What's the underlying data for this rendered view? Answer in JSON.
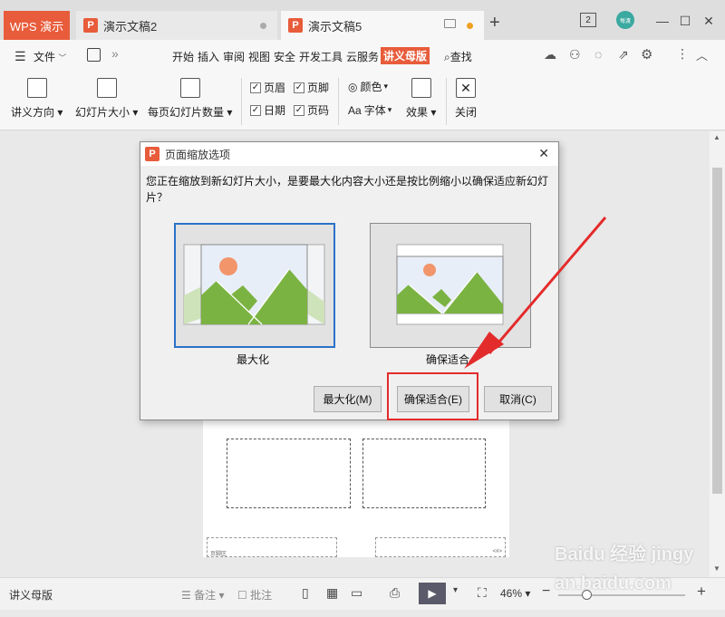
{
  "titlebar": {
    "app_tab": "WPS 演示",
    "doc_tabs": [
      {
        "label": "演示文稿2",
        "active": false
      },
      {
        "label": "演示文稿5",
        "active": true
      }
    ],
    "new_tab": "+",
    "badge": "2",
    "avatar": "每渡"
  },
  "menubar": {
    "file": "文件",
    "items": [
      "开始",
      "插入",
      "审阅",
      "视图",
      "安全",
      "开发工具",
      "云服务"
    ],
    "active": "讲义母版",
    "search": "查找"
  },
  "ribbon": {
    "orientation": "讲义方向",
    "slide_size": "幻灯片大小",
    "per_page": "每页幻灯片数量",
    "header": "页眉",
    "footer": "页脚",
    "date": "日期",
    "page_no": "页码",
    "colors": "颜色",
    "fonts": "字体",
    "effects": "效果",
    "close": "关闭"
  },
  "dialog": {
    "title": "页面缩放选项",
    "message": "您正在缩放到新幻灯片大小，是要最大化内容大小还是按比例缩小以确保适应新幻灯片？",
    "option_maximize": "最大化",
    "option_fit": "确保适合",
    "btn_maximize": "最大化(M)",
    "btn_fit": "确保适合(E)",
    "btn_cancel": "取消(C)"
  },
  "page": {
    "footer_left": "页脚区",
    "footer_right": "<#>"
  },
  "statusbar": {
    "mode": "讲义母版",
    "notes": "备注",
    "comments": "批注",
    "zoom": "46%"
  },
  "watermark": "Baidu 经验 jingyan.baidu.com",
  "colors": {
    "accent": "#e85c3b",
    "highlight": "#e32b2b",
    "selection": "#2a72c8",
    "sky": "#e8eef8",
    "mountain": "#7bb342",
    "sun": "#f2956b"
  }
}
